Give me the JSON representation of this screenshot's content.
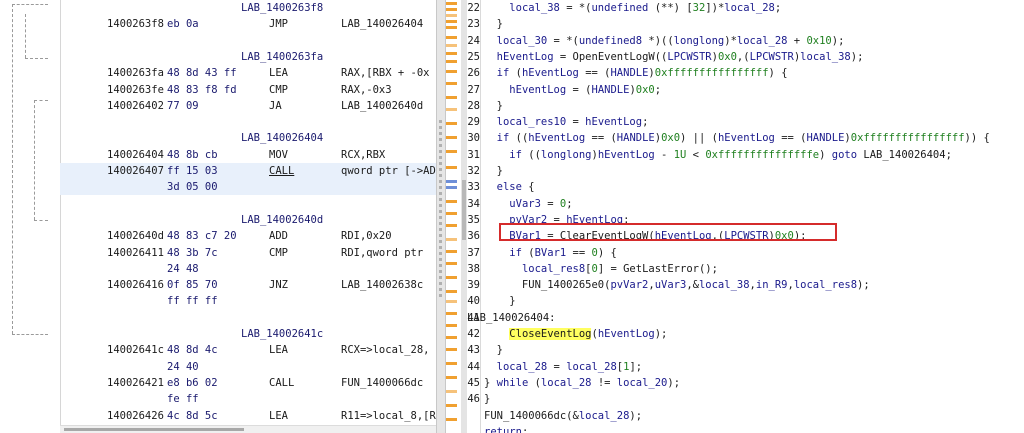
{
  "listing": {
    "rows": [
      {
        "addr": "",
        "bytes": "",
        "mn": "",
        "op": "",
        "label": "LAB_1400263f8"
      },
      {
        "addr": "1400263f8",
        "bytes": "eb 0a",
        "mn": "JMP",
        "op": "LAB_140026404",
        "label": ""
      },
      {
        "addr": "",
        "bytes": "",
        "mn": "",
        "op": "",
        "label": ""
      },
      {
        "addr": "",
        "bytes": "",
        "mn": "",
        "op": "",
        "label": "LAB_1400263fa"
      },
      {
        "addr": "1400263fa",
        "bytes": "48 8d 43 ff",
        "mn": "LEA",
        "op": "RAX,[RBX + -0x",
        "label": ""
      },
      {
        "addr": "1400263fe",
        "bytes": "48 83 f8 fd",
        "mn": "CMP",
        "op": "RAX,-0x3",
        "label": ""
      },
      {
        "addr": "140026402",
        "bytes": "77 09",
        "mn": "JA",
        "op": "LAB_14002640d",
        "label": ""
      },
      {
        "addr": "",
        "bytes": "",
        "mn": "",
        "op": "",
        "label": ""
      },
      {
        "addr": "",
        "bytes": "",
        "mn": "",
        "op": "",
        "label": "LAB_140026404"
      },
      {
        "addr": "140026404",
        "bytes": "48 8b cb",
        "mn": "MOV",
        "op": "RCX,RBX",
        "label": ""
      },
      {
        "addr": "140026407",
        "bytes": "ff 15 03",
        "mn": "CALL",
        "op": "qword ptr [->AD",
        "label": ""
      },
      {
        "addr": "",
        "bytes": "3d 05 00",
        "mn": "",
        "op": "",
        "label": ""
      },
      {
        "addr": "",
        "bytes": "",
        "mn": "",
        "op": "",
        "label": ""
      },
      {
        "addr": "",
        "bytes": "",
        "mn": "",
        "op": "",
        "label": "LAB_14002640d"
      },
      {
        "addr": "14002640d",
        "bytes": "48 83 c7 20",
        "mn": "ADD",
        "op": "RDI,0x20",
        "label": ""
      },
      {
        "addr": "140026411",
        "bytes": "48 3b 7c",
        "mn": "CMP",
        "op": "RDI,qword ptr",
        "label": ""
      },
      {
        "addr": "",
        "bytes": "24 48",
        "mn": "",
        "op": "",
        "label": ""
      },
      {
        "addr": "140026416",
        "bytes": "0f 85 70",
        "mn": "JNZ",
        "op": "LAB_14002638c",
        "label": ""
      },
      {
        "addr": "",
        "bytes": "ff ff ff",
        "mn": "",
        "op": "",
        "label": ""
      },
      {
        "addr": "",
        "bytes": "",
        "mn": "",
        "op": "",
        "label": ""
      },
      {
        "addr": "",
        "bytes": "",
        "mn": "",
        "op": "",
        "label": "LAB_14002641c"
      },
      {
        "addr": "14002641c",
        "bytes": "48 8d 4c",
        "mn": "LEA",
        "op": "RCX=>local_28,",
        "label": ""
      },
      {
        "addr": "",
        "bytes": "24 40",
        "mn": "",
        "op": "",
        "label": ""
      },
      {
        "addr": "140026421",
        "bytes": "e8 b6 02",
        "mn": "CALL",
        "op": "FUN_1400066dc",
        "label": ""
      },
      {
        "addr": "",
        "bytes": "fe ff",
        "mn": "",
        "op": "",
        "label": ""
      },
      {
        "addr": "140026426",
        "bytes": "4c 8d 5c",
        "mn": "LEA",
        "op": "R11=>local_8,[R",
        "label": ""
      }
    ]
  },
  "decompiler": {
    "lines": [
      {
        "n": "22",
        "text": "    local_38 = *(undefined (**) [32])*local_28;"
      },
      {
        "n": "23",
        "text": "  }"
      },
      {
        "n": "24",
        "text": "  local_30 = *(undefined8 *)((longlong)*local_28 + 0x10);"
      },
      {
        "n": "25",
        "text": "  hEventLog = OpenEventLogW((LPCWSTR)0x0,(LPCWSTR)local_38);"
      },
      {
        "n": "26",
        "text": "  if (hEventLog == (HANDLE)0xffffffffffffffff) {"
      },
      {
        "n": "27",
        "text": "    hEventLog = (HANDLE)0x0;"
      },
      {
        "n": "28",
        "text": "  }"
      },
      {
        "n": "29",
        "text": "  local_res10 = hEventLog;"
      },
      {
        "n": "30",
        "text": "  if ((hEventLog == (HANDLE)0x0) || (hEventLog == (HANDLE)0xffffffffffffffff)) {"
      },
      {
        "n": "31",
        "text": "    if ((longlong)hEventLog - 1U < 0xfffffffffffffffe) goto LAB_140026404;"
      },
      {
        "n": "32",
        "text": "  }"
      },
      {
        "n": "33",
        "text": "  else {"
      },
      {
        "n": "34",
        "text": "    uVar3 = 0;"
      },
      {
        "n": "35",
        "text": "    pvVar2 = hEventLog;"
      },
      {
        "n": "36",
        "text": "    BVar1 = ClearEventLogW(hEventLog,(LPCWSTR)0x0);"
      },
      {
        "n": "37",
        "text": "    if (BVar1 == 0) {"
      },
      {
        "n": "38",
        "text": "      local_res8[0] = GetLastError();"
      },
      {
        "n": "39",
        "text": "      FUN_1400265e0(pvVar2,uVar3,&local_38,in_R9,local_res8);"
      },
      {
        "n": "40",
        "text": "    }"
      },
      {
        "n": "41",
        "text": "LAB_140026404:"
      },
      {
        "n": "42",
        "text": "    CloseEventLog(hEventLog);"
      },
      {
        "n": "43",
        "text": "  }"
      },
      {
        "n": "44",
        "text": "  local_28 = local_28[1];"
      },
      {
        "n": "45",
        "text": "} while (local_28 != local_20);"
      },
      {
        "n": "46",
        "text": "}"
      },
      {
        "n": "",
        "text": "FUN_1400066dc(&local_28);"
      },
      {
        "n": "",
        "text": "return;"
      }
    ],
    "highlighted_line": "36",
    "highlighted_token": "CloseEventLog"
  },
  "colors": {
    "highlight_box": "#d52b2b",
    "token_highlight": "#ffff60",
    "overview_marker": "#f0a030"
  }
}
